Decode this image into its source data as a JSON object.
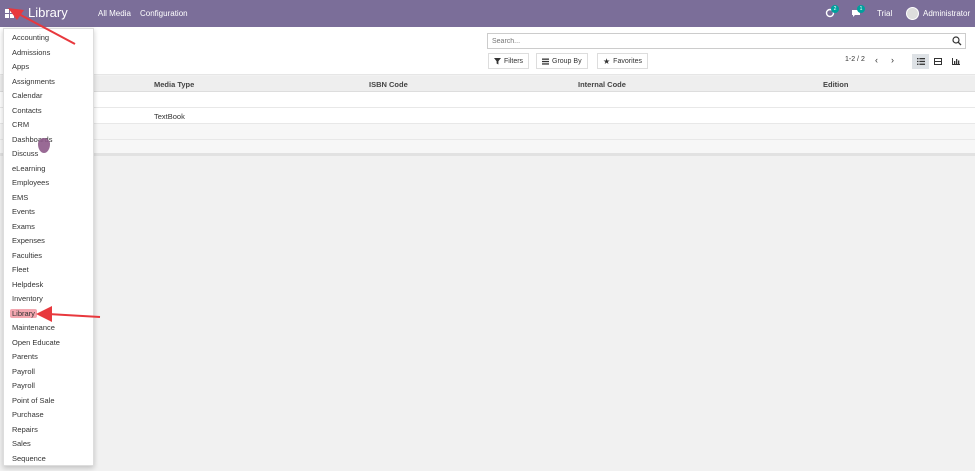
{
  "navbar": {
    "brand": "Library",
    "menu": [
      "All Media",
      "Configuration"
    ],
    "activity_count": "2",
    "message_count": "1",
    "trial_label": "Trial",
    "user": "Administrator"
  },
  "search": {
    "placeholder": "Search..."
  },
  "filters": {
    "filters_label": "Filters",
    "groupby_label": "Group By",
    "favorites_label": "Favorites"
  },
  "pager": {
    "text": "1-2 / 2"
  },
  "table": {
    "columns": [
      "Media Type",
      "ISBN Code",
      "Internal Code",
      "Edition"
    ],
    "rows": [
      {
        "media_type": ""
      },
      {
        "media_type": "TextBook"
      }
    ]
  },
  "apps_menu": {
    "items": [
      "Accounting",
      "Admissions",
      "Apps",
      "Assignments",
      "Calendar",
      "Contacts",
      "CRM",
      "Dashboards",
      "Discuss",
      "eLearning",
      "Employees",
      "EMS",
      "Events",
      "Exams",
      "Expenses",
      "Faculties",
      "Fleet",
      "Helpdesk",
      "Inventory",
      "Library",
      "Maintenance",
      "Open Educate",
      "Parents",
      "Payroll",
      "Payroll",
      "Point of Sale",
      "Purchase",
      "Repairs",
      "Sales",
      "Sequence"
    ],
    "highlighted": "Library"
  },
  "colors": {
    "navbar": "#7b6e99",
    "highlight": "#f3a7b0",
    "arrow": "#e8383d"
  },
  "icons": [
    "apps-grid-icon",
    "search-icon",
    "filter-icon",
    "group-by-icon",
    "star-icon",
    "chevron-left-icon",
    "chevron-right-icon",
    "list-view-icon",
    "kanban-view-icon",
    "graph-view-icon",
    "activity-icon",
    "chat-icon"
  ]
}
